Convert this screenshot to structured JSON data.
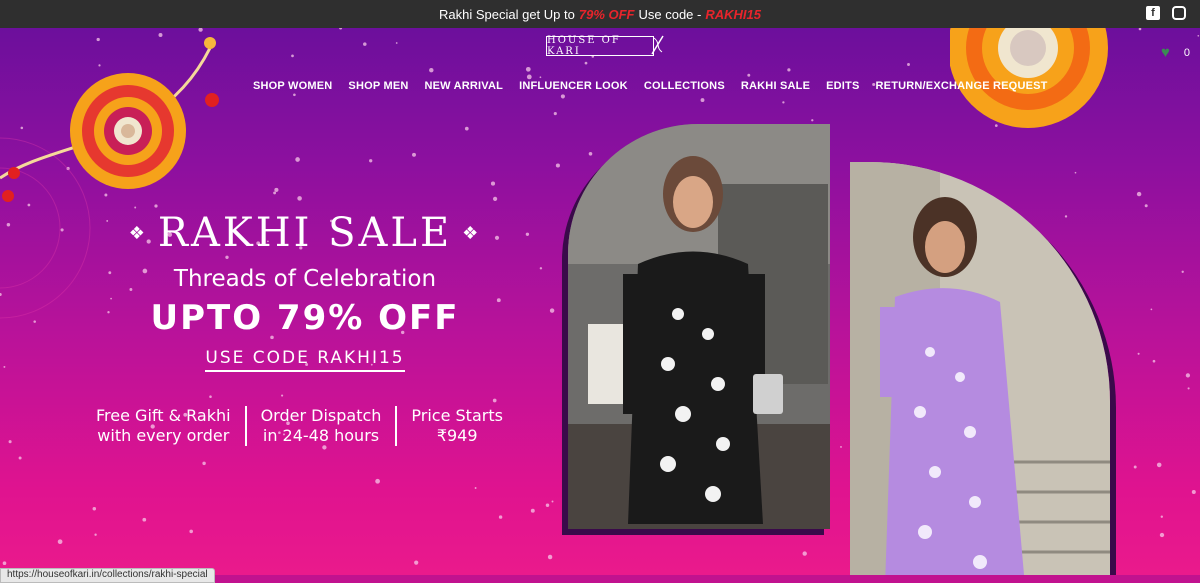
{
  "topbar": {
    "promo_prefix": "Rakhi Special get Up to",
    "promo_percent": "79% OFF",
    "promo_mid": "Use code -",
    "promo_code": "RAKHI15",
    "social": [
      "facebook-icon",
      "instagram-icon"
    ]
  },
  "header": {
    "logo_text": "HOUSE OF KARI",
    "wishlist_count": "0"
  },
  "nav": {
    "items": [
      "SHOP WOMEN",
      "SHOP MEN",
      "NEW ARRIVAL",
      "INFLUENCER LOOK",
      "COLLECTIONS",
      "RAKHI SALE",
      "EDITS",
      "RETURN/EXCHANGE REQUEST"
    ]
  },
  "hero": {
    "title": "RAKHI SALE",
    "subtitle": "Threads of Celebration",
    "offer": "UPTO 79% OFF",
    "code": "USE CODE RAKHI15",
    "features": [
      {
        "line1": "Free Gift & Rakhi",
        "line2": "with every order"
      },
      {
        "line1": "Order Dispatch",
        "line2": "in 24-48 hours"
      },
      {
        "line1": "Price Starts",
        "line2": "₹949"
      }
    ]
  },
  "statusbar": {
    "url": "https://houseofkari.in/collections/rakhi-special"
  },
  "colors": {
    "topbar_bg": "#2f2f2f",
    "promo_accent": "#e8242b",
    "hero_top": "#6c0f9c",
    "hero_bottom": "#ea1a8c"
  }
}
